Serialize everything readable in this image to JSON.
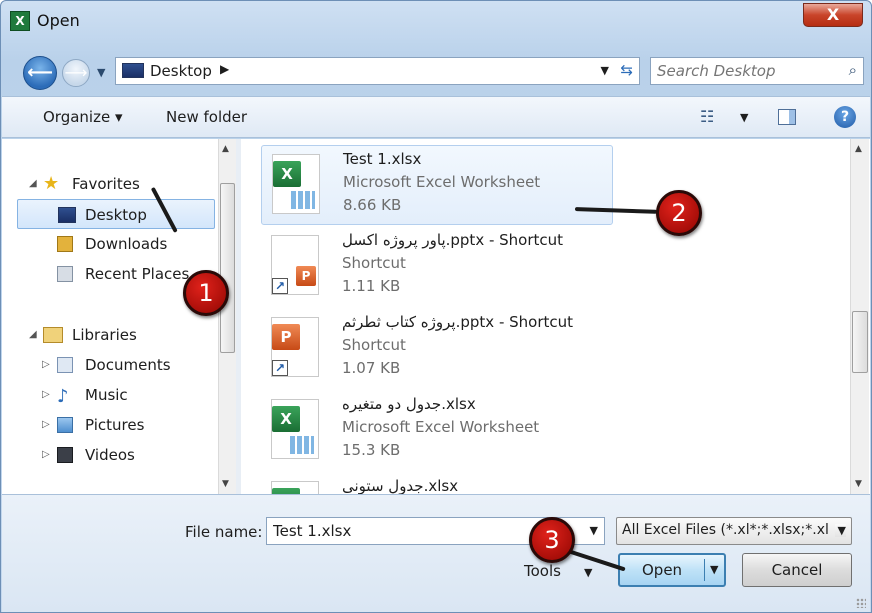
{
  "window": {
    "title": "Open",
    "close_glyph": "X"
  },
  "address": {
    "location": "Desktop"
  },
  "search": {
    "placeholder": "Search Desktop"
  },
  "toolbar": {
    "organize": "Organize ▾",
    "new_folder": "New folder"
  },
  "nav": {
    "favorites": "Favorites",
    "desktop": "Desktop",
    "downloads": "Downloads",
    "recent_places": "Recent Places",
    "libraries": "Libraries",
    "documents": "Documents",
    "music": "Music",
    "pictures": "Pictures",
    "videos": "Videos"
  },
  "files": [
    {
      "name": "Test 1.xlsx",
      "type": "Microsoft Excel Worksheet",
      "size": "8.66 KB",
      "icon": "excel-file-icon"
    },
    {
      "name": "پاور پروژه اکسل.pptx - Shortcut",
      "type": "Shortcut",
      "size": "1.11 KB",
      "icon": "powerpoint-shortcut-icon"
    },
    {
      "name": "پروژه کتاب ثطرثم.pptx - Shortcut",
      "type": "Shortcut",
      "size": "1.07 KB",
      "icon": "powerpoint-shortcut-icon"
    },
    {
      "name": "جدول دو متغیره.xlsx",
      "type": "Microsoft Excel Worksheet",
      "size": "15.3 KB",
      "icon": "excel-file-icon"
    },
    {
      "name": "جدول ستونی.xlsx",
      "type": "",
      "size": "",
      "icon": "excel-file-icon"
    }
  ],
  "bottom": {
    "file_name_label": "File name:",
    "file_name_value": "Test 1.xlsx",
    "filter": "All Excel Files (*.xl*;*.xlsx;*.xl",
    "tools": "Tools",
    "open": "Open",
    "cancel": "Cancel"
  },
  "annotations": {
    "step1": "1",
    "step2": "2",
    "step3": "3",
    "color": "#c8140e"
  }
}
